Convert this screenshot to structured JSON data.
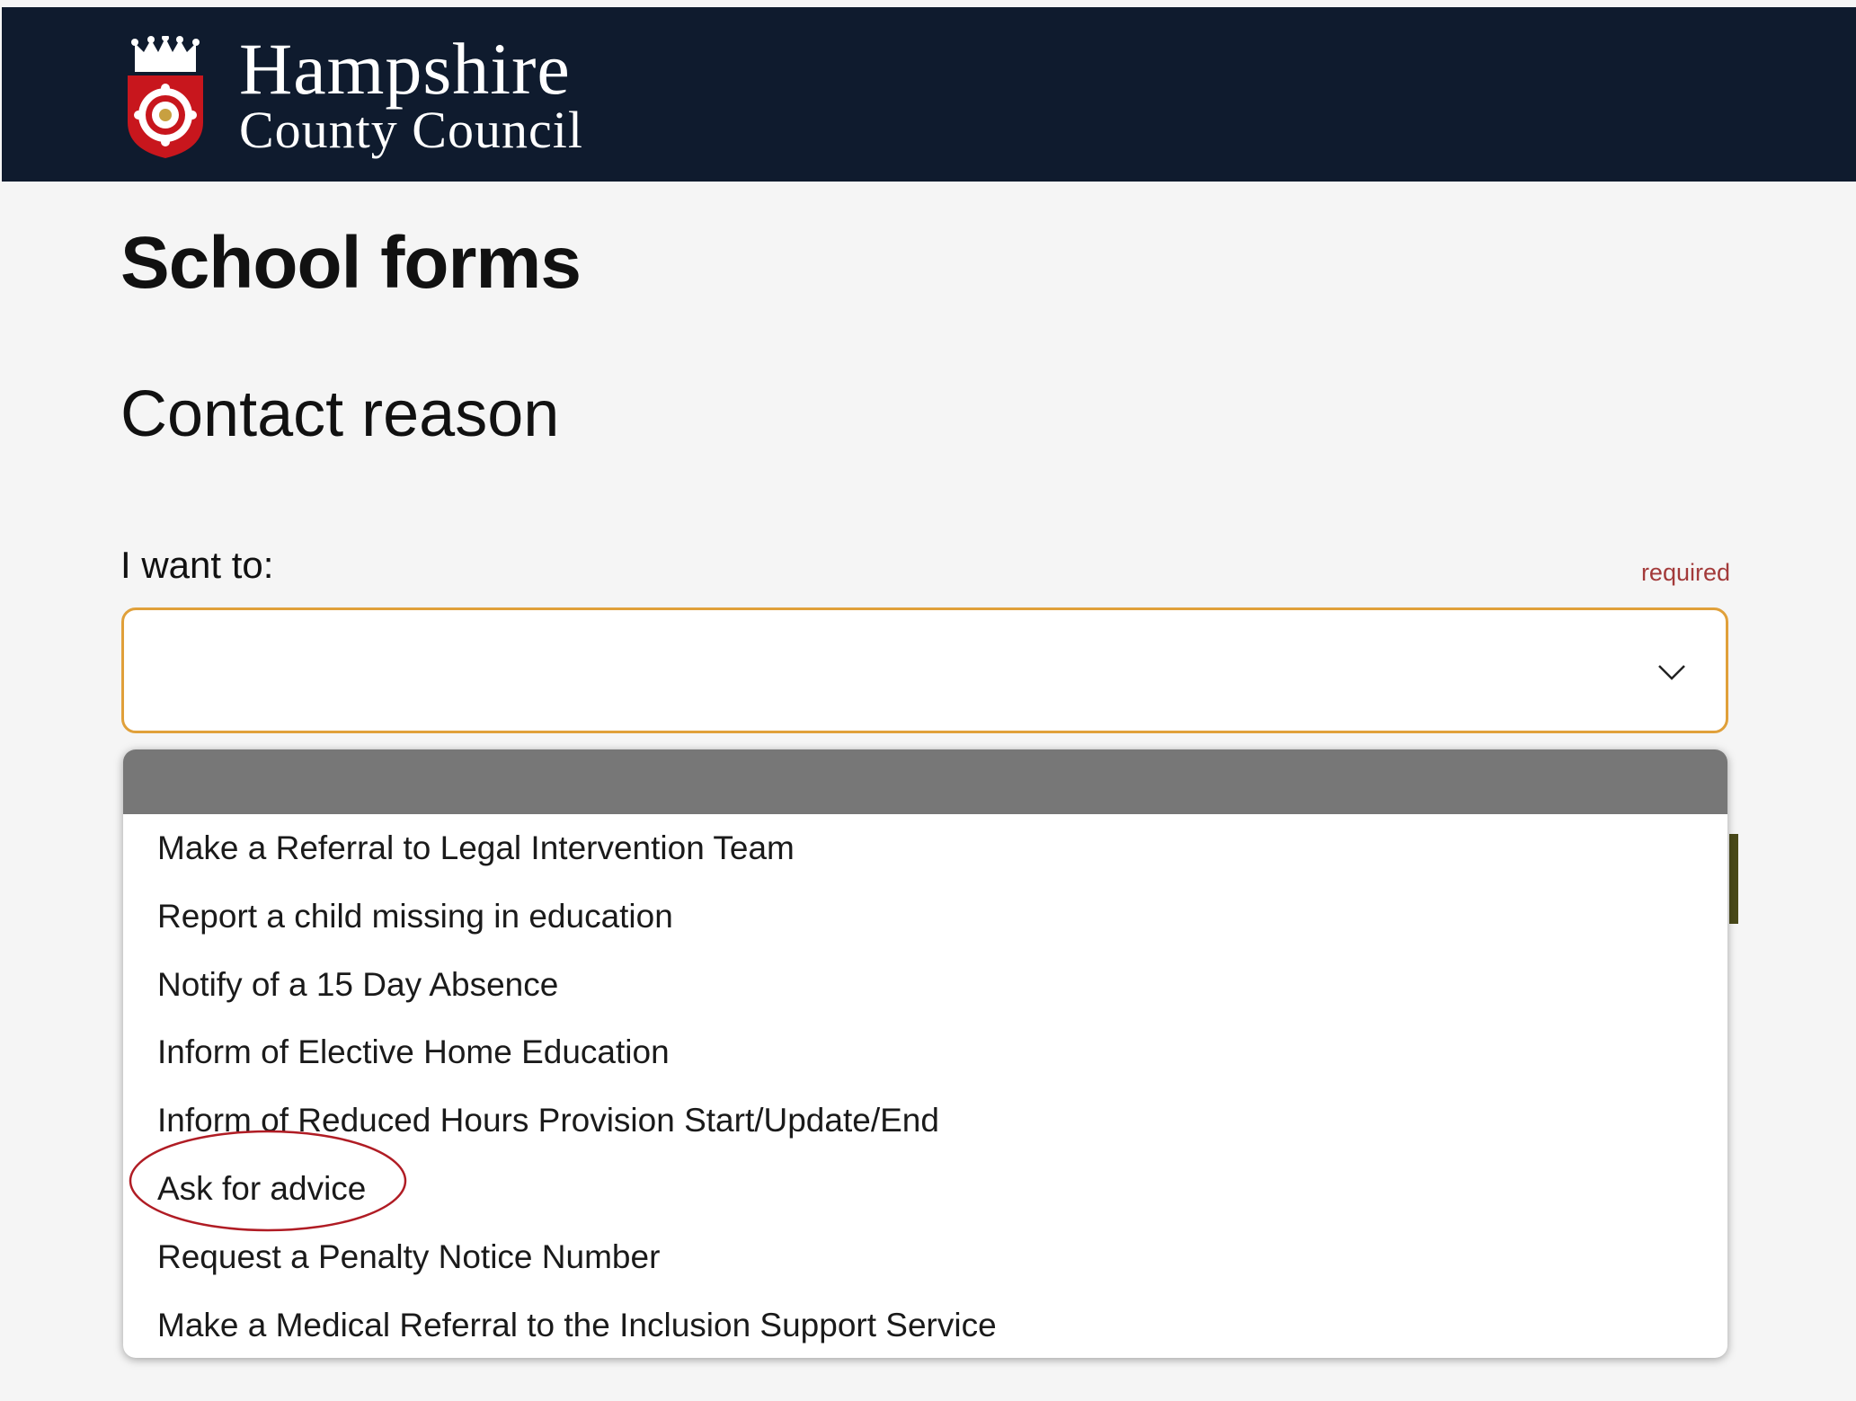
{
  "header": {
    "logo_line1": "Hampshire",
    "logo_line2": "County Council",
    "background_color": "#0f1b2e",
    "crest_icon": "hampshire-rose-crest"
  },
  "page_title": "School forms",
  "section_heading": "Contact reason",
  "field": {
    "label": "I want to:",
    "required_text": "required",
    "selected_value": "",
    "focus_border_color": "#e0a03a",
    "chevron_icon": "chevron-down-icon"
  },
  "dropdown": {
    "highlighted_option_index": 0,
    "highlight_color": "#777777",
    "options": [
      "Make a Referral to Legal Intervention Team",
      "Report a child missing in education",
      "Notify of a 15 Day Absence",
      "Inform of Elective Home Education",
      "Inform of Reduced Hours Provision Start/Update/End",
      "Ask for advice",
      "Request a Penalty Notice Number",
      "Make a Medical Referral to the Inclusion Support Service"
    ]
  },
  "annotation": {
    "circled_option": "Ask for advice",
    "color": "#b01c24"
  }
}
